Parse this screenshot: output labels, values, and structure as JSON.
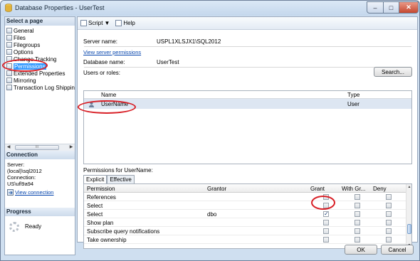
{
  "window": {
    "title": "Database Properties - UserTest"
  },
  "left": {
    "select_page_header": "Select a page",
    "pages": [
      "General",
      "Files",
      "Filegroups",
      "Options",
      "Change Tracking",
      "Permissions",
      "Extended Properties",
      "Mirroring",
      "Transaction Log Shipping"
    ],
    "selected_page": "Permissions",
    "connection_header": "Connection",
    "server_label": "Server:",
    "server_value": "(local)\\sql2012",
    "connection_label": "Connection:",
    "connection_value": "US\\ufl9a94",
    "view_connection": "View connection",
    "progress_header": "Progress",
    "progress_status": "Ready",
    "scrollbar_grip": "III"
  },
  "toolbar": {
    "script_label": "Script",
    "help_label": "Help"
  },
  "main": {
    "server_name_label": "Server name:",
    "server_name_value": "USPL1XLSJX1\\SQL2012",
    "view_server_permissions": "View server permissions",
    "database_name_label": "Database name:",
    "database_name_value": "UserTest",
    "users_or_roles_label": "Users or roles:",
    "search_button": "Search...",
    "users_columns": {
      "name": "Name",
      "type": "Type"
    },
    "users": [
      {
        "name": "UserName",
        "type": "User"
      }
    ],
    "permissions_for_label": "Permissions for UserName:",
    "tabs": [
      "Explicit",
      "Effective"
    ],
    "perm_columns": {
      "permission": "Permission",
      "grantor": "Grantor",
      "grant": "Grant",
      "with_grant": "With Gr...",
      "deny": "Deny"
    },
    "permissions": [
      {
        "permission": "References",
        "grantor": "",
        "grant": false,
        "with_grant": false,
        "deny": false
      },
      {
        "permission": "Select",
        "grantor": "",
        "grant": false,
        "with_grant": false,
        "deny": false
      },
      {
        "permission": "Select",
        "grantor": "dbo",
        "grant": true,
        "with_grant": false,
        "deny": false
      },
      {
        "permission": "Show plan",
        "grantor": "",
        "grant": false,
        "with_grant": false,
        "deny": false
      },
      {
        "permission": "Subscribe query notifications",
        "grantor": "",
        "grant": false,
        "with_grant": false,
        "deny": false
      },
      {
        "permission": "Take ownership",
        "grantor": "",
        "grant": false,
        "with_grant": false,
        "deny": false
      }
    ]
  },
  "footer": {
    "ok_label": "OK",
    "cancel_label": "Cancel"
  },
  "colors": {
    "selection": "#3399ff",
    "highlight_ring": "#d81f26"
  }
}
